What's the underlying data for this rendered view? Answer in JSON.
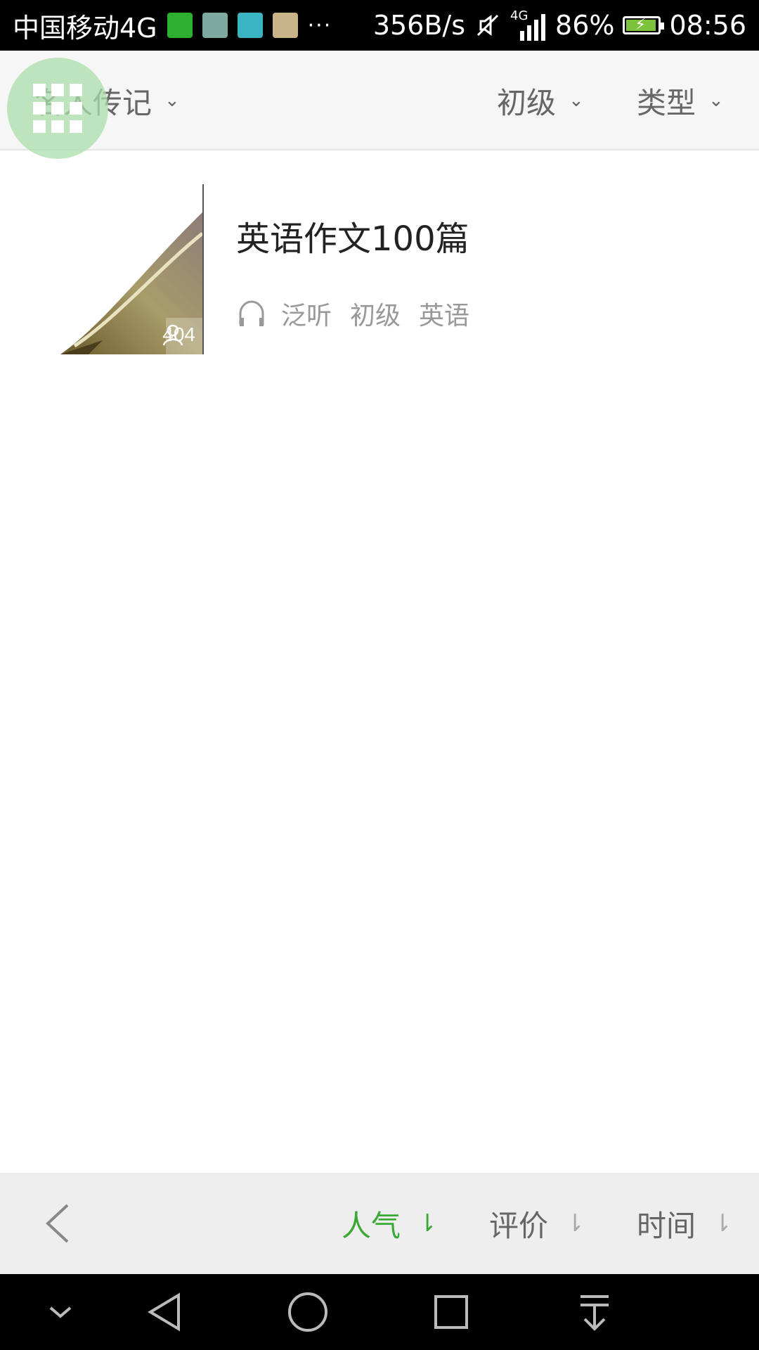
{
  "status_bar": {
    "carrier": "中国移动4G",
    "more": "···",
    "speed": "356B/s",
    "network": "4G",
    "battery": "86%",
    "battery_level": 0.86,
    "time": "08:56"
  },
  "filters": {
    "category": "名人传记",
    "level": "初级",
    "type": "类型"
  },
  "list": {
    "items": [
      {
        "title": "英语作文100篇",
        "listen_count": "404",
        "tags": [
          "泛听",
          "初级",
          "英语"
        ]
      }
    ]
  },
  "sort_bar": {
    "hot": "人气",
    "rating": "评价",
    "time": "时间",
    "active": "hot",
    "active_color": "#3aa935"
  }
}
